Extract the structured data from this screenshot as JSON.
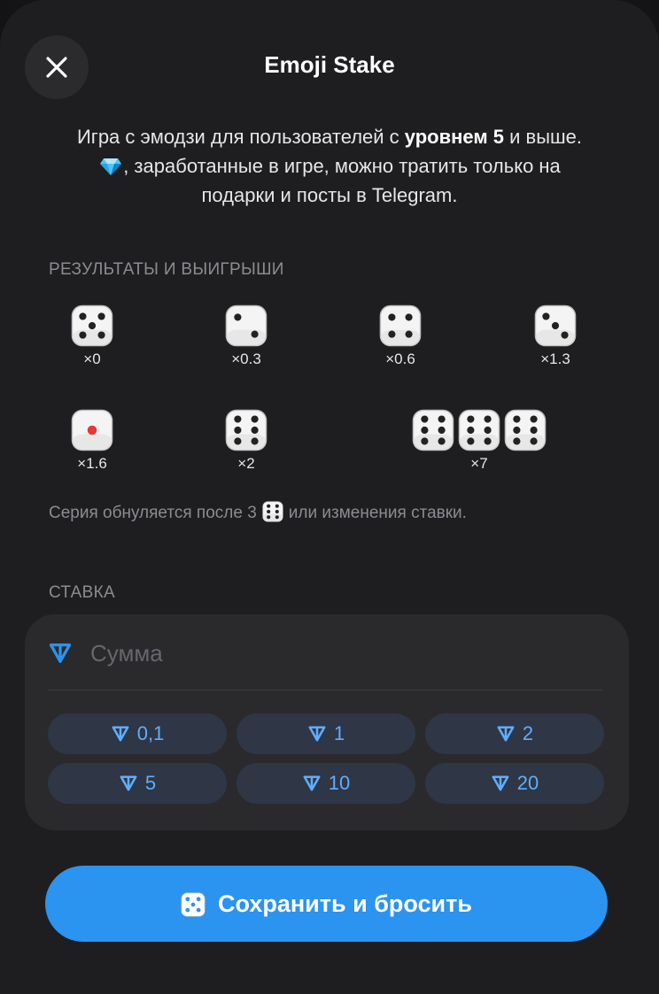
{
  "dialog": {
    "title": "Emoji Stake",
    "description": {
      "part1": "Игра с эмодзи для пользователей с ",
      "bold": "уровнем 5",
      "part2": " и выше. ",
      "part3": ", заработанные в игре, можно тратить только на подарки и посты в Telegram."
    },
    "results_label": "РЕЗУЛЬТАТЫ И ВЫИГРЫШИ",
    "results": [
      {
        "multiplier": "×0",
        "faces": [
          5
        ]
      },
      {
        "multiplier": "×0.3",
        "faces": [
          2
        ]
      },
      {
        "multiplier": "×0.6",
        "faces": [
          4
        ]
      },
      {
        "multiplier": "×1.3",
        "faces": [
          3
        ]
      },
      {
        "multiplier": "×1.6",
        "faces": [
          1
        ]
      },
      {
        "multiplier": "×2",
        "faces": [
          6
        ]
      },
      {
        "multiplier": "×7",
        "faces": [
          6,
          6,
          6
        ]
      }
    ],
    "note_before": "Серия обнуляется после 3",
    "note_after": "или изменения ставки.",
    "stake_label": "СТАВКА",
    "amount_placeholder": "Сумма",
    "chips": [
      "0,1",
      "1",
      "2",
      "5",
      "10",
      "20"
    ],
    "cta_label": "Сохранить и бросить"
  },
  "colors": {
    "accent": "#2b93f0",
    "chip_text": "#5eaeff",
    "die_pip_red": "#e53935"
  },
  "icons": {
    "close": "close-icon",
    "gem": "gem-icon",
    "ton": "ton-icon",
    "die": "die-icon"
  }
}
